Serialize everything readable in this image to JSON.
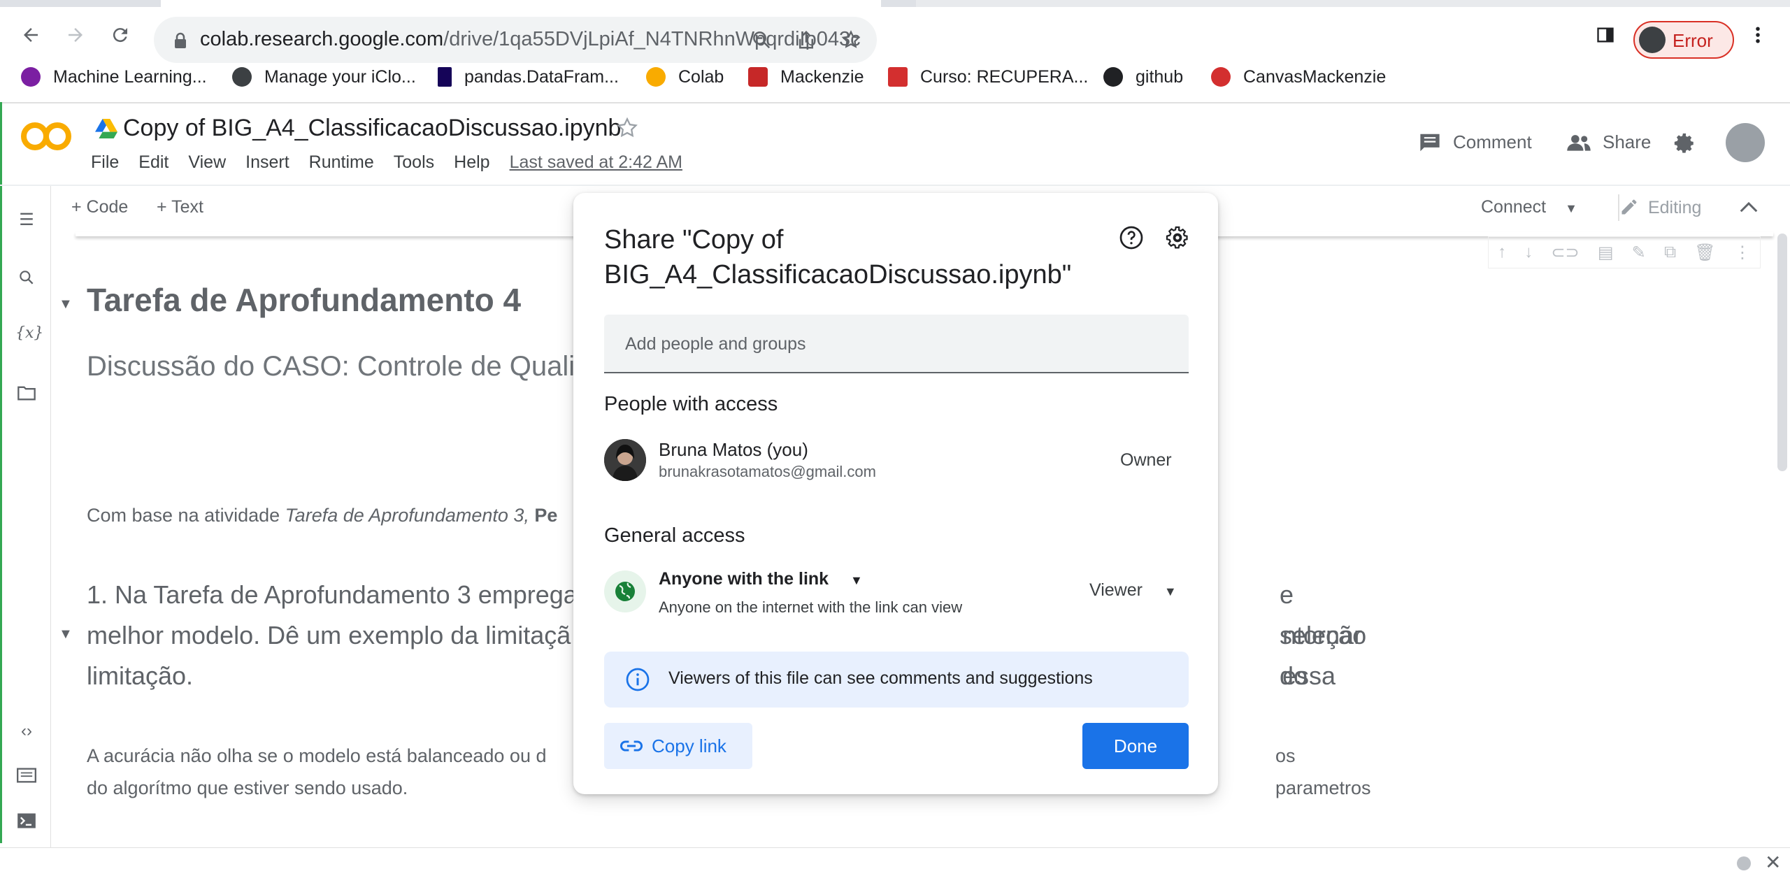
{
  "browser": {
    "url_host": "colab.research.google.com",
    "url_path": "/drive/1qa55DVjLpiAf_N4TNRhnWpqrdiIp043c",
    "profile_status": "Error",
    "bookmarks": [
      {
        "label": "Machine Learning...",
        "color": "#7b1fa2"
      },
      {
        "label": "Manage your iClo...",
        "color": "#3c4043"
      },
      {
        "label": "pandas.DataFram...",
        "color": "#150458"
      },
      {
        "label": "Colab",
        "color": "#f9ab00"
      },
      {
        "label": "Mackenzie",
        "color": "#c62828"
      },
      {
        "label": "Curso: RECUPERA...",
        "color": "#d32f2f"
      },
      {
        "label": "github",
        "color": "#202124"
      },
      {
        "label": "CanvasMackenzie",
        "color": "#d32f2f"
      }
    ]
  },
  "colab": {
    "notebook_title": "Copy of BIG_A4_ClassificacaoDiscussao.ipynb",
    "menu": [
      "File",
      "Edit",
      "View",
      "Insert",
      "Runtime",
      "Tools",
      "Help"
    ],
    "last_saved": "Last saved at 2:42 AM",
    "comment_label": "Comment",
    "share_label": "Share",
    "add_code": "+ Code",
    "add_text": "+ Text",
    "connect_label": "Connect",
    "editing_label": "Editing"
  },
  "notebook": {
    "heading1": "Tarefa de Aprofundamento 4",
    "heading2": "Discussão do CASO: Controle de Quali",
    "para_plain": "Com base na atividade ",
    "para_italic": "Tarefa de Aprofundamento 3, ",
    "para_bold": "Pe",
    "q1_left_line1": "1. Na Tarefa de Aprofundamento 3 emprega",
    "q1_right_line1": "e seleção do",
    "q1_left_line2": "melhor modelo. Dê um exemplo da limitaçã",
    "q1_right_line2": "ntornar essa",
    "q1_line3": "limitação.",
    "ans_left_line1": "A acurácia não olha se o modelo está balanceado ou d",
    "ans_right_line1": "os parametros",
    "ans_line2": "do algorítmo que estiver sendo usado."
  },
  "dialog": {
    "title": "Share \"Copy of BIG_A4_ClassificacaoDiscussao.ipynb\"",
    "add_placeholder": "Add people and groups",
    "people_heading": "People with access",
    "person_name": "Bruna Matos (you)",
    "person_email": "brunakrasotamatos@gmail.com",
    "person_role": "Owner",
    "general_heading": "General access",
    "access_type": "Anyone with the link",
    "access_desc": "Anyone on the internet with the link can view",
    "access_role": "Viewer",
    "info_text": "Viewers of this file can see comments and suggestions",
    "copy_link": "Copy link",
    "done": "Done"
  }
}
